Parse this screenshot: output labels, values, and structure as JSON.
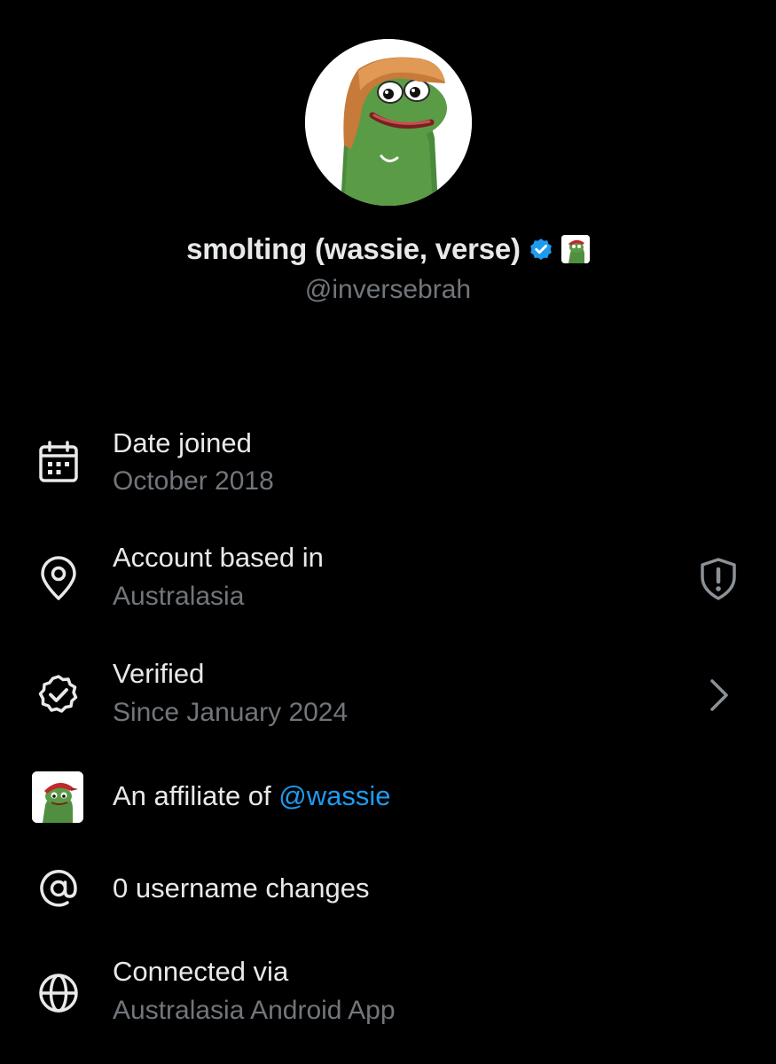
{
  "profile": {
    "display_name": "smolting (wassie, verse)",
    "handle": "@inversebrah"
  },
  "about": {
    "date_joined": {
      "title": "Date joined",
      "value": "October 2018",
      "icon": "calendar-icon"
    },
    "account_based_in": {
      "title": "Account based in",
      "value": "Australasia",
      "icon": "location-pin-icon",
      "right_icon": "shield-alert-icon"
    },
    "verified": {
      "title": "Verified",
      "value": "Since January 2024",
      "icon": "verified-badge-icon",
      "right_icon": "chevron-right-icon"
    },
    "affiliate": {
      "prefix": "An affiliate of ",
      "link": "@wassie"
    },
    "username_changes": {
      "title": "0 username changes",
      "icon": "at-sign-icon"
    },
    "connected_via": {
      "title": "Connected via",
      "value": "Australasia Android App",
      "icon": "globe-icon"
    }
  },
  "colors": {
    "background": "#000000",
    "primary_text": "#e7e9ea",
    "secondary_text": "#71767b",
    "link": "#1d9bf0",
    "verified_blue": "#1d9bf0"
  }
}
